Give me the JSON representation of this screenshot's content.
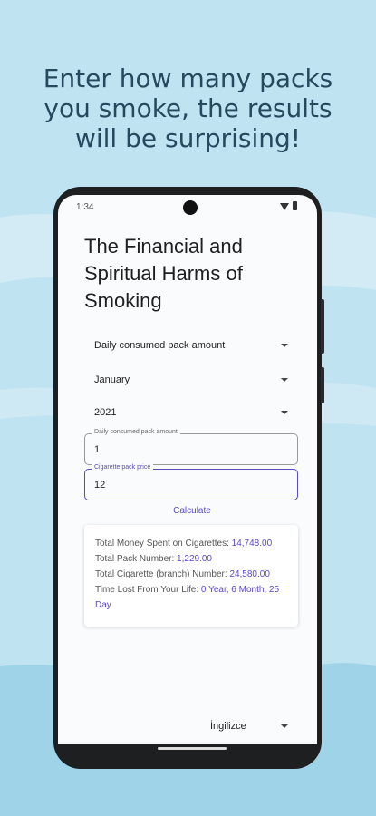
{
  "promo": {
    "line1": "Enter how many packs",
    "line2": "you smoke, the results",
    "line3": "will be surprising!"
  },
  "status_bar": {
    "time": "1:34"
  },
  "app": {
    "title": "The Financial and Spiritual Harms of Smoking",
    "dropdowns": {
      "type": "Daily consumed pack amount",
      "month": "January",
      "year": "2021"
    },
    "fields": {
      "daily_packs": {
        "label": "Daily consumed pack amount",
        "value": "1"
      },
      "pack_price": {
        "label": "Cigarette pack price",
        "value": "12"
      }
    },
    "calculate_label": "Calculate",
    "results": {
      "money_label": "Total Money Spent on Cigarettes:",
      "money_value": "14,748.00",
      "pack_label": "Total Pack Number:",
      "pack_value": "1,229.00",
      "cigarette_label": "Total Cigarette (branch) Number:",
      "cigarette_value": "24,580.00",
      "time_label": "Time Lost From Your Life:",
      "time_value": "0 Year, 6 Month, 25 Day"
    },
    "language": "İngilizce"
  },
  "colors": {
    "accent": "#5b49c6",
    "promo_text": "#254a5e",
    "background": "#bfe3f1"
  }
}
